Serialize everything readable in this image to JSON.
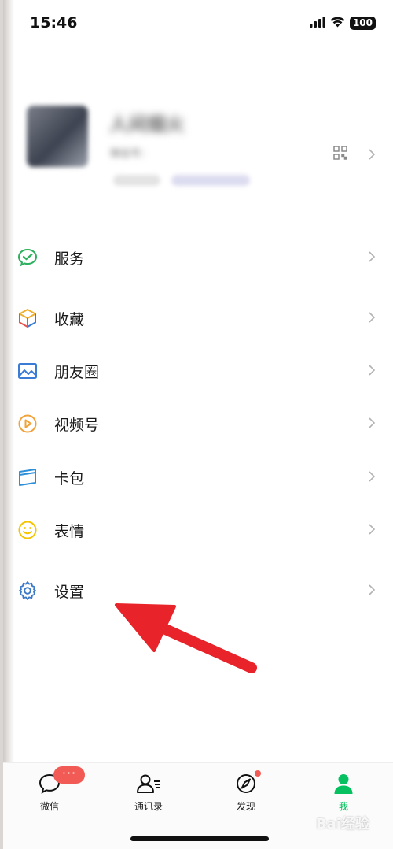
{
  "status_bar": {
    "time": "15:46",
    "battery": "100"
  },
  "profile": {
    "name": "人间烟火",
    "wechat_id": "微信号：",
    "status_tag": "+ 状态",
    "friends_tag": "5个朋友"
  },
  "menu": [
    {
      "label": "服务",
      "icon": "wechat-pay-icon",
      "color": "#2bb05d"
    },
    {
      "label": "收藏",
      "icon": "cube-icon",
      "color": "#f0b030"
    },
    {
      "label": "朋友圈",
      "icon": "image-icon",
      "color": "#3a7bd5"
    },
    {
      "label": "视频号",
      "icon": "play-circle-icon",
      "color": "#f2a23a"
    },
    {
      "label": "卡包",
      "icon": "wallet-icon",
      "color": "#2d8fd8"
    },
    {
      "label": "表情",
      "icon": "smiley-icon",
      "color": "#f5c400"
    },
    {
      "label": "设置",
      "icon": "gear-icon",
      "color": "#3a78c8"
    }
  ],
  "tabs": [
    {
      "label": "微信",
      "icon": "chat-bubble-icon"
    },
    {
      "label": "通讯录",
      "icon": "contacts-icon"
    },
    {
      "label": "发现",
      "icon": "compass-icon"
    },
    {
      "label": "我",
      "icon": "person-icon",
      "active": true
    }
  ],
  "badge_text": "···",
  "watermark": "Bai经验",
  "accent_color": "#07c160",
  "arrow_color": "#e8242a"
}
